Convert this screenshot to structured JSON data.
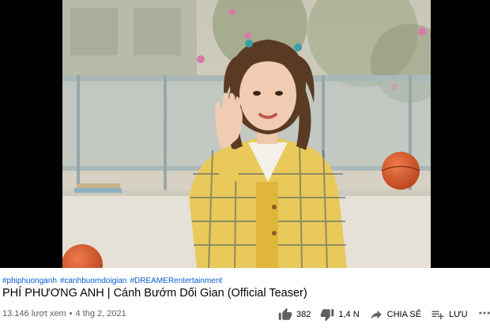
{
  "video": {
    "hashtags": [
      "#phiphuonganh",
      "#canhbuomdoigian",
      "#DREAMERentertainment"
    ],
    "title": "PHÍ PHƯƠNG ANH | Cánh Bướm Dối Gian (Official Teaser)",
    "views": "13.146 lượt xem",
    "separator": "•",
    "date": "4 thg 2, 2021"
  },
  "actions": {
    "like_count": "382",
    "dislike_count": "1,4 N",
    "share_label": "CHIA SẺ",
    "save_label": "LƯU"
  },
  "icons": {
    "like": "thumb-up-icon",
    "dislike": "thumb-down-icon",
    "share": "share-arrow-icon",
    "save": "playlist-add-icon",
    "more": "more-horizontal-icon"
  },
  "colors": {
    "link": "#065fd4",
    "text": "#030303",
    "secondary": "#606060",
    "icon": "#606060"
  }
}
